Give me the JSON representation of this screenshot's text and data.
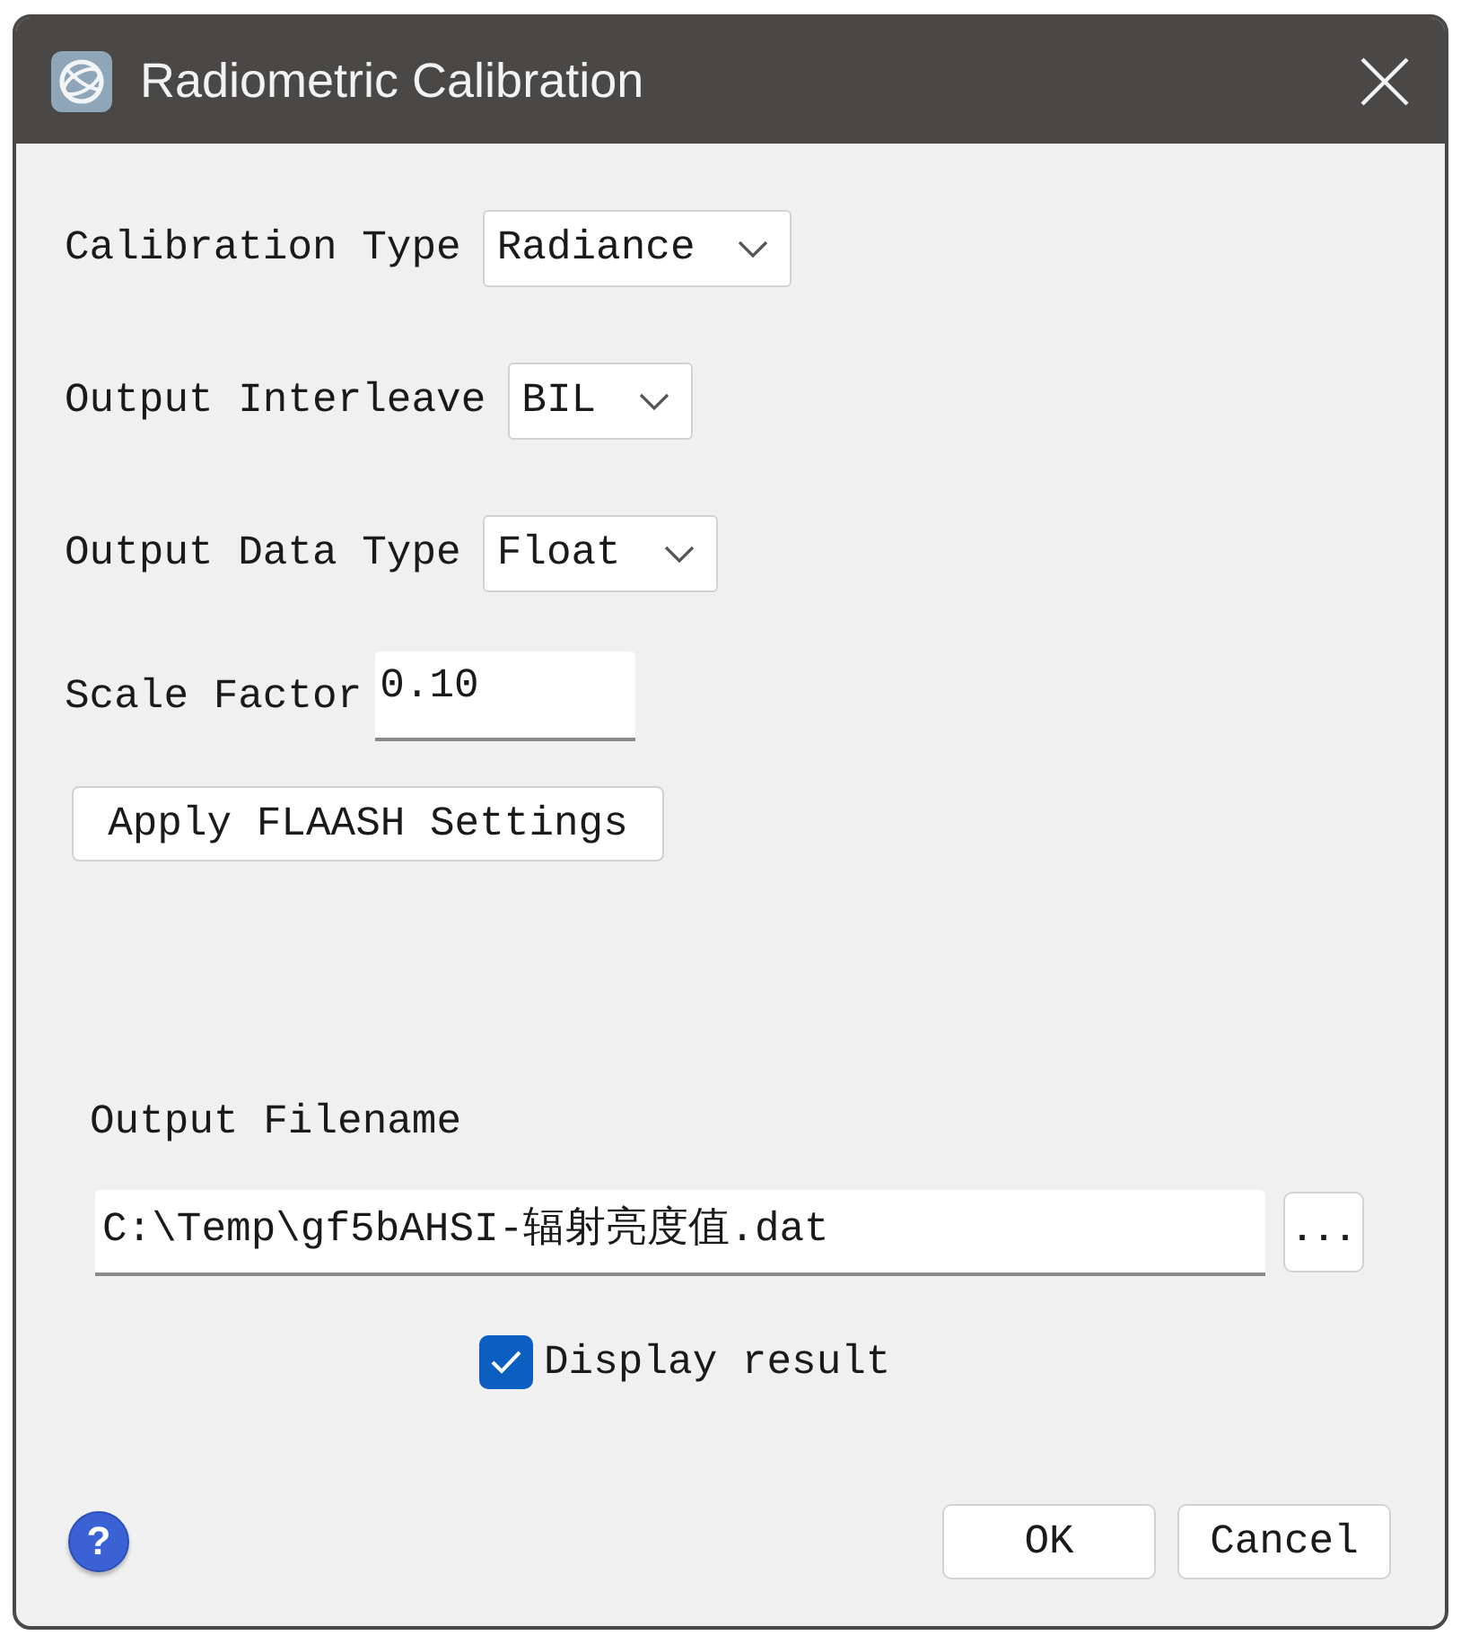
{
  "window": {
    "title": "Radiometric Calibration"
  },
  "fields": [
    {
      "kind": "dropdown",
      "label": "Calibration Type",
      "value": "Radiance"
    },
    {
      "kind": "dropdown",
      "label": "Output Interleave",
      "value": "BIL"
    },
    {
      "kind": "dropdown",
      "label": "Output Data Type",
      "value": "Float"
    },
    {
      "kind": "text",
      "label": "Scale Factor",
      "value": "0.10"
    }
  ],
  "apply_button": {
    "label": "Apply FLAASH Settings"
  },
  "output_file": {
    "label": "Output Filename",
    "value": "C:\\Temp\\gf5bAHSI-辐射亮度值.dat",
    "browse_button": "..."
  },
  "display_result": {
    "label": "Display result",
    "checked": true
  },
  "help_button": "?",
  "buttons": [
    {
      "label": "OK"
    },
    {
      "label": "Cancel"
    }
  ]
}
